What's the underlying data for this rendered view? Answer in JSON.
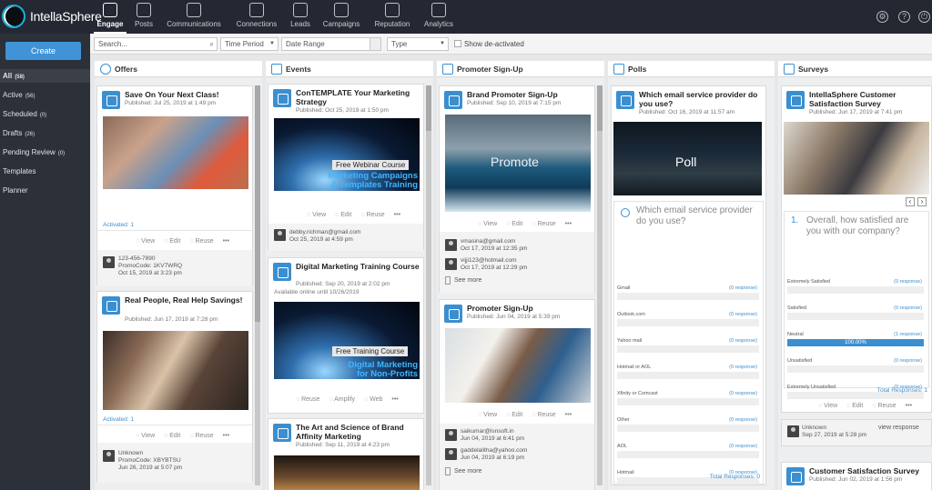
{
  "app": {
    "logo": "IntellaSphere"
  },
  "nav": [
    {
      "label": "Engage",
      "icon": "engage-icon",
      "active": true
    },
    {
      "label": "Posts",
      "icon": "posts-icon"
    },
    {
      "label": "Communications",
      "icon": "communications-icon"
    },
    {
      "label": "Connections",
      "icon": "connections-icon"
    },
    {
      "label": "Leads",
      "icon": "leads-icon"
    },
    {
      "label": "Campaigns",
      "icon": "campaigns-icon"
    },
    {
      "label": "Reputation",
      "icon": "reputation-icon"
    },
    {
      "label": "Analytics",
      "icon": "analytics-icon"
    }
  ],
  "topright": {
    "settings": "gear-icon",
    "help": "?",
    "power": "⏻"
  },
  "sidebar": {
    "create": "Create",
    "items": [
      {
        "label": "All",
        "count": "(58)"
      },
      {
        "label": "Active",
        "count": "(56)"
      },
      {
        "label": "Scheduled",
        "count": "(0)"
      },
      {
        "label": "Drafts",
        "count": "(26)"
      },
      {
        "label": "Pending Review",
        "count": "(0)"
      },
      {
        "label": "Templates",
        "count": ""
      },
      {
        "label": "Planner",
        "count": ""
      }
    ]
  },
  "filters": {
    "search_placeholder": "Search...",
    "time_period": "Time Period",
    "date_range": "Date Range",
    "type": "Type",
    "show_deactivated": "Show de-activated"
  },
  "columns": {
    "offers": {
      "title": "Offers",
      "cards": [
        {
          "title": "Save On Your Next Class!",
          "published": "Published: Jul 25, 2019  at  1:49 pm",
          "activated": "Activated: 1",
          "actions": [
            "View",
            "Edit",
            "Reuse",
            "•••"
          ],
          "contact": "123-456-7890",
          "promo": "PromoCode: 1KV7WRQ",
          "date": "Oct 15, 2019  at  3:23 pm"
        },
        {
          "title": "Real People, Real Help Savings!",
          "published": "Published: Jun 17, 2019  at  7:28 pm",
          "activated": "Activated: 1",
          "actions": [
            "View",
            "Edit",
            "Reuse",
            "•••"
          ],
          "contact": "Unknown",
          "promo": "PromoCode: XBYBTSU",
          "date": "Jun 26, 2019  at  5:07 pm"
        }
      ]
    },
    "events": {
      "title": "Events",
      "cards": [
        {
          "title": "ConTEMPLATE Your Marketing Strategy",
          "published": "Published: Oct 25, 2019  at  1:50 pm",
          "banner_tag": "Free Webinar Course",
          "banner_l1": "Marketing Campaigns",
          "banner_l2": "& Templates Training",
          "actions": [
            "View",
            "Edit",
            "Reuse",
            "•••"
          ],
          "contact": "debby.richman@gmail.com",
          "date": "Oct 25, 2019  at  4:59 pm"
        },
        {
          "title": "Digital Marketing Training Course",
          "published": "Published: Sep 20, 2019  at  2:02 pm",
          "available": "Available online until 10/26/2019",
          "banner_tag": "Free Training Course",
          "banner_l1": "Digital Marketing",
          "banner_l2": "for Non-Profits",
          "actions": [
            "Reuse",
            "Amplify",
            "Web",
            "•••"
          ]
        },
        {
          "title": "The Art and Science of Brand Affinity Marketing",
          "published": "Published: Sep 11, 2019  at  4:23 pm"
        }
      ]
    },
    "promoter": {
      "title": "Promoter Sign-Up",
      "cards": [
        {
          "title": "Brand Promoter Sign-Up",
          "published": "Published: Sep 10, 2019  at  7:15 pm",
          "image_text": "Promote",
          "actions": [
            "View",
            "Edit",
            "Reuse",
            "•••"
          ],
          "contacts": [
            {
              "email": "vmasina@gmail.com",
              "date": "Oct 17, 2019  at  12:35 pm"
            },
            {
              "email": "vijji123@hotmail.com",
              "date": "Oct 17, 2019  at  12:29 pm"
            }
          ],
          "see_more": "See more"
        },
        {
          "title": "Promoter Sign-Up",
          "published": "Published: Jun 04, 2019  at  5:39 pm",
          "actions": [
            "View",
            "Edit",
            "Reuse",
            "•••"
          ],
          "contacts": [
            {
              "email": "saikumar@lsnsoft.in",
              "date": "Jun 04, 2019  at  6:41 pm"
            },
            {
              "email": "gaddelalitha@yahoo.com",
              "date": "Jun 04, 2019  at  6:19 pm"
            }
          ],
          "see_more": "See more"
        }
      ]
    },
    "polls": {
      "title": "Polls",
      "cards": [
        {
          "title": "Which email service provider do you use?",
          "published": "Published: Oct 16, 2019  at  11:57 am",
          "image_text": "Poll",
          "question": "Which email service provider do you use?",
          "options": [
            {
              "label": "Gmail",
              "resp": "(0 response)"
            },
            {
              "label": "Outlook.com",
              "resp": "(0 response)"
            },
            {
              "label": "Yahoo mail",
              "resp": "(0 response)"
            },
            {
              "label": "Hotmail or AOL",
              "resp": "(0 response)"
            },
            {
              "label": "Xfinity or Comcast",
              "resp": "(0 response)"
            },
            {
              "label": "Other",
              "resp": "(0 response)"
            },
            {
              "label": "AOL",
              "resp": "(0 response)"
            },
            {
              "label": "Hotmail",
              "resp": "(0 response)"
            }
          ],
          "total": "Total Responses: 0"
        }
      ]
    },
    "surveys": {
      "title": "Surveys",
      "cards": [
        {
          "title": "IntellaSphere Customer Satisfaction Survey",
          "published": "Published: Jun 17, 2019  at  7:41 pm",
          "question_no": "1.",
          "question": "Overall, how satisfied are you with our company?",
          "options": [
            {
              "label": "Extremely Satisfied",
              "resp": "(0 response)",
              "pct": 0
            },
            {
              "label": "Satisfied",
              "resp": "(0 response)",
              "pct": 0
            },
            {
              "label": "Neutral",
              "resp": "(1 response)",
              "pct": 100,
              "pct_label": "100.00%"
            },
            {
              "label": "Unsatisfied",
              "resp": "(0 response)",
              "pct": 0
            },
            {
              "label": "Extremely Unsatisfied",
              "resp": "(0 response)",
              "pct": 0
            }
          ],
          "total": "Total Responses: 1",
          "actions": [
            "View",
            "Edit",
            "Reuse",
            "•••"
          ],
          "contact": "Unknown",
          "view_response": "view response",
          "date": "Sep 27, 2019  at  5:28 pm"
        },
        {
          "title": "Customer Satisfaction Survey",
          "published": "Published: Jun 02, 2019  at  1:56 pm"
        }
      ]
    }
  },
  "colors": {
    "topbar": "#232832",
    "accent": "#3b8fd0",
    "sidebar": "#2c3038"
  }
}
